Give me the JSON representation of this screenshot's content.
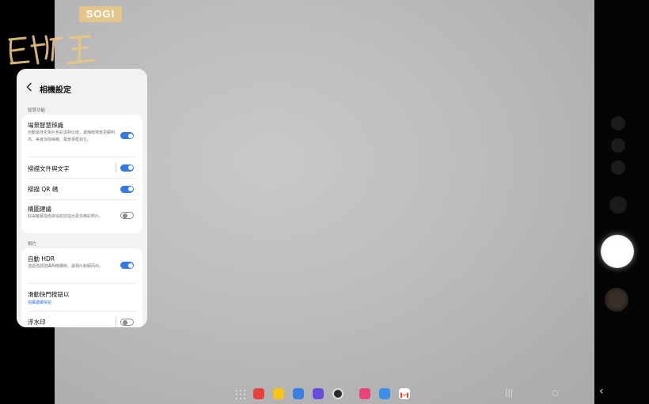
{
  "watermark": {
    "badge": "SOGI"
  },
  "settings": {
    "title": "相機設定",
    "sections": [
      {
        "label": "智慧功能",
        "items": [
          {
            "title": "場景智慧辨識",
            "description": "自動最佳化相片色彩與對比度，讓晦暗場景更顯明亮、美食加強鳴精、風景相框如生。",
            "toggle": "on"
          },
          {
            "title": "掃描文件與文字",
            "toggle": "on"
          },
          {
            "title": "掃描 QR 碼",
            "toggle": "on"
          },
          {
            "title": "構圖建議",
            "description": "取得螢幕指南來協助您拍出更多精彩照片。",
            "toggle": "off"
          }
        ]
      },
      {
        "label": "相片",
        "items": [
          {
            "title": "自動 HDR",
            "description": "透過強調拍攝明暗細節，讓相片脫穎而出。",
            "toggle": "on"
          },
          {
            "title": "滑動快門按鈕以",
            "subtitle": "拍攝連續快拍"
          },
          {
            "title": "浮水印",
            "toggle": "off"
          }
        ]
      }
    ]
  },
  "dock": {
    "apps": [
      {
        "name": "app-drawer-icon",
        "color": "#dddddd"
      },
      {
        "name": "notes-icon",
        "color": "#e8403a"
      },
      {
        "name": "files-icon",
        "color": "#f5c518"
      },
      {
        "name": "messages-icon",
        "color": "#3b7de0"
      },
      {
        "name": "internet-icon",
        "color": "#6a4cdc"
      },
      {
        "name": "camera-app-icon",
        "color": "#2a2a2a"
      },
      {
        "name": "gallery-icon",
        "color": "#e9447a"
      },
      {
        "name": "store-icon",
        "color": "#3e8fe8"
      },
      {
        "name": "gmail-icon",
        "color": "#ffffff"
      }
    ]
  },
  "navbar": {
    "recents": "|||",
    "home": "○",
    "back": "‹"
  }
}
